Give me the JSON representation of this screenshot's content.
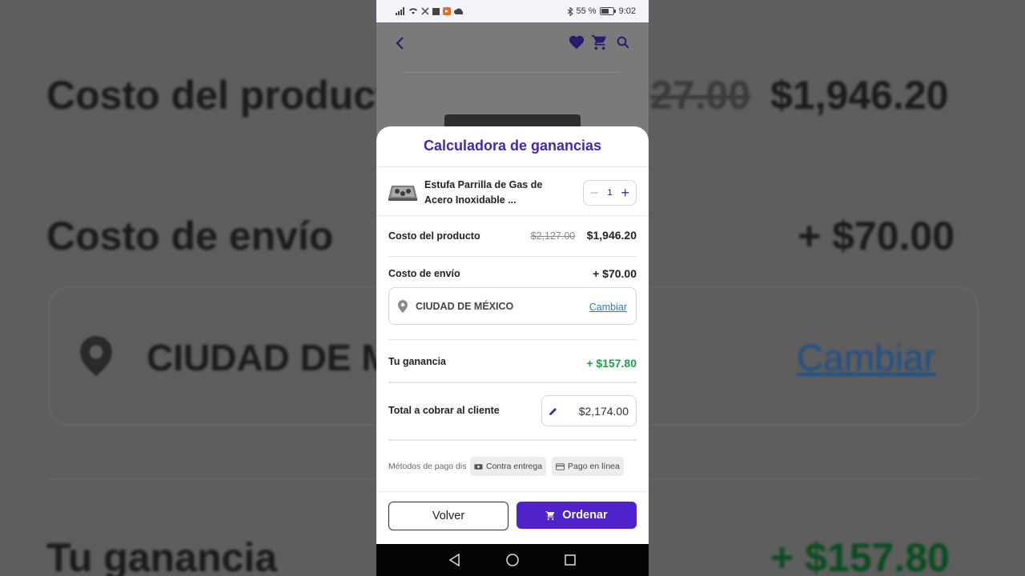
{
  "background": {
    "product_cost_label": "Costo del producto",
    "product_cost_strike": "27.00",
    "product_cost_value": "$1,946.20",
    "shipping_label": "Costo de envío",
    "shipping_value": "+ $70.00",
    "city": "CIUDAD DE M",
    "change_link": "Cambiar",
    "profit_label": "Tu ganancia",
    "profit_value": "+ $157.80"
  },
  "status_bar": {
    "battery": "55 %",
    "time": "9:02"
  },
  "sheet": {
    "title": "Calculadora de ganancias",
    "item": {
      "name": "Estufa Parrilla de Gas de Acero Inoxidable ...",
      "quantity": "1"
    },
    "product_cost": {
      "label": "Costo del producto",
      "original": "$2,127.00",
      "value": "$1,946.20"
    },
    "shipping": {
      "label": "Costo de envío",
      "value": "+ $70.00",
      "city": "CIUDAD DE MÉXICO",
      "change_label": "Cambiar"
    },
    "profit": {
      "label": "Tu ganancia",
      "value": "+ $157.80"
    },
    "total": {
      "label": "Total a cobrar al cliente",
      "value": "$2,174.00"
    },
    "payments": {
      "label": "Métodos de pago dis",
      "methods": [
        "Contra entrega",
        "Pago en línea"
      ]
    },
    "buttons": {
      "back": "Volver",
      "order": "Ordenar"
    }
  },
  "colors": {
    "accent": "#5022cc",
    "title": "#4a25a6",
    "profit_green": "#1e9e4c",
    "link": "#2d7dbf"
  }
}
